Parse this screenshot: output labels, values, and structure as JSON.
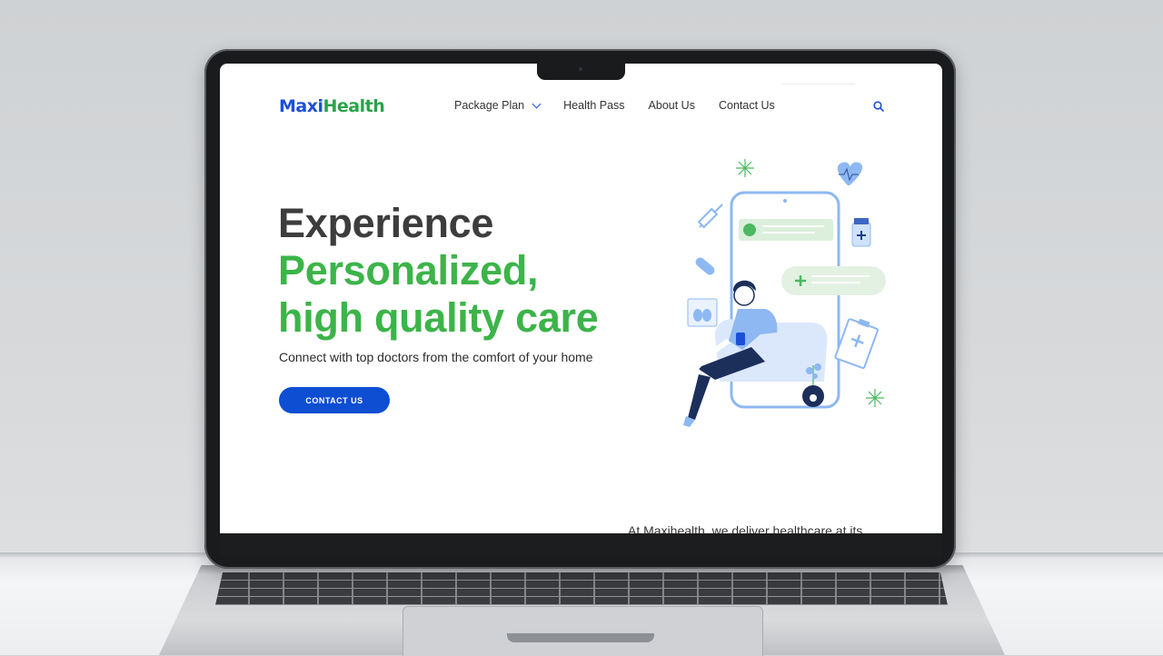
{
  "site": {
    "logo": {
      "part1": "Maxi",
      "part2": "Health"
    },
    "nav": {
      "items": [
        {
          "label": "Package Plan",
          "has_dropdown": true
        },
        {
          "label": "Health Pass"
        },
        {
          "label": "About Us"
        },
        {
          "label": "Contact Us"
        }
      ],
      "search_icon": "search-icon"
    },
    "hero": {
      "title_line1": "Experience",
      "title_line2": "Personalized,",
      "title_line3": "high quality care",
      "subtitle": "Connect with top doctors from the comfort of your home",
      "cta_label": "CONTACT US"
    },
    "below_fold_text": "At Maxihealth, we deliver healthcare at its"
  },
  "colors": {
    "brand_blue": "#1c4fd8",
    "brand_green": "#2aa34a",
    "heading_green": "#3cb449",
    "button_blue": "#0d4ed3",
    "illustration_blue": "#8db8f2"
  }
}
